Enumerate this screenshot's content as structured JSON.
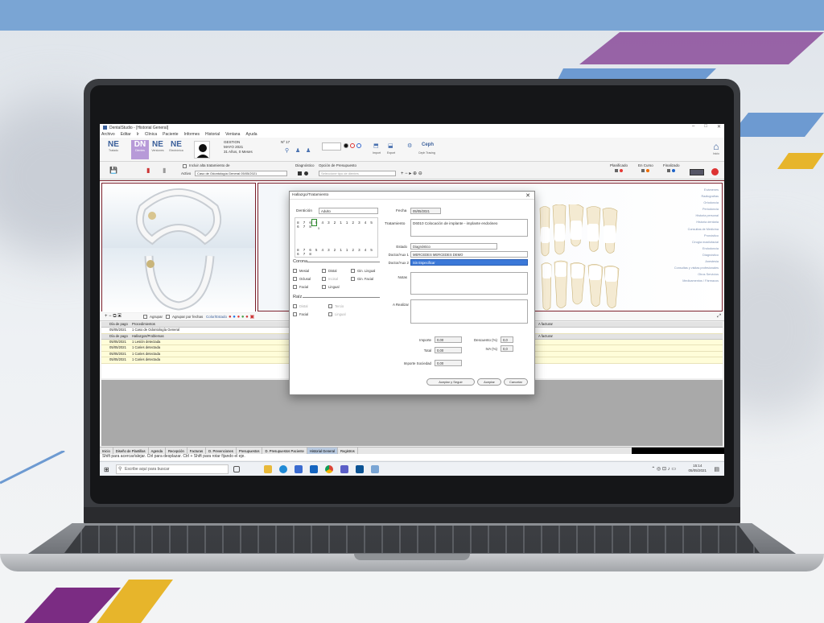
{
  "window": {
    "title": "DentalStudio - [Historial General]",
    "controls": [
      "–",
      "□",
      "✕"
    ]
  },
  "menu": [
    "Archivo",
    "Editar",
    "Ir",
    "Clínica",
    "Paciente",
    "Informes",
    "Historial",
    "Ventana",
    "Ayuda"
  ],
  "ribbon": {
    "modules": [
      {
        "code": "NE",
        "label": "Tratado"
      },
      {
        "code": "DN",
        "label": "Dientes"
      },
      {
        "code": "NE",
        "label": "Versiones"
      },
      {
        "code": "NE",
        "label": "Electrónica"
      }
    ],
    "patient": {
      "name": "GESTION",
      "line2": "MAYO 2021",
      "line3": "31 Años, 0 Meses",
      "number": "Nº 17"
    },
    "tool_labels": [
      "Import",
      "Export",
      "Ceph Tracing",
      "Ceph"
    ],
    "home_label": "Inicio"
  },
  "toolbar": {
    "checkbox_label": "Incluir alta tratamiento de",
    "active_label": "Activo",
    "treatment_select": "Caso de Odontología General 05/05/2021",
    "diagnostic_label": "Diagnóstico",
    "budget_label": "Opción de Presupuesto",
    "budget_select": "Seleccione tipo de dientes",
    "stages": [
      {
        "label": "Planificado",
        "color": "#e53935"
      },
      {
        "label": "En Curso",
        "color": "#ef6c00"
      },
      {
        "label": "Finalizado",
        "color": "#1e63c8"
      }
    ]
  },
  "right_links": [
    "Exámenes",
    "Radiografías",
    "Ortodoncia",
    "Periodoncia",
    "Historia personal",
    "Historia dentaria",
    "Consultas de Medicina",
    "Pronóstico",
    "Cirugía maxilofacial",
    "Endodoncia",
    "Diagnóstico",
    "Anestesia",
    "Consultas y visitas profesionales",
    "Otros Servicios",
    "Medicamentos / Fármacos"
  ],
  "grid_toolbar": {
    "agrupar_label": "Agrupar",
    "agrupar_fechas_label": "Agrupar por fechas",
    "color_label": "Color/Estado"
  },
  "grid": {
    "section1": {
      "headers": [
        "Día de pago",
        "Procedimientos",
        "",
        "A facturar"
      ],
      "rows": [
        {
          "date": "05/05/2021",
          "desc": "1 Caso de Odontología General"
        }
      ]
    },
    "section2": {
      "headers": [
        "Día de pago",
        "Hallazgos/Problemas",
        "",
        "A facturar"
      ],
      "rows": [
        {
          "date": "05/05/2021",
          "desc": "1 Lesión detectada"
        },
        {
          "date": "05/05/2021",
          "desc": "1 Caries detectada"
        },
        {
          "date": "05/05/2021",
          "desc": "1 Caries detectada"
        },
        {
          "date": "05/05/2021",
          "desc": "1 Caries detectada"
        }
      ]
    }
  },
  "tabs": [
    "Inicio",
    "Diseño de Plantillas",
    "Agenda",
    "Recepción",
    "Facturas",
    "D. Prevenciones",
    "Presupuestos",
    "D. Presupuestos Paciente",
    "Historial General",
    "Registros"
  ],
  "active_tab": "Historial General",
  "status": "Shift para acercar/alejar. Ctrl para desplazar. Ctrl + Shift para rotar fijando el eje.",
  "taskbar": {
    "search_placeholder": "Escribe aquí para buscar",
    "time": "15:14",
    "date": "05/05/2021"
  },
  "dialog": {
    "title": "Hallazgo/Tratamiento",
    "denticion_label": "Dentición",
    "denticion_value": "Adulto",
    "fecha_label": "Fecha",
    "fecha_value": "05/05/2021",
    "tratamiento_label": "Tratamiento",
    "tratamiento_value": "D6010 Colocación de implante - implante endoóseo",
    "upper_numbers": "8 7 6 5 4 3 2 1 1 2 3 4 5 6 7 8",
    "lower_numbers": "8 7 6 5 4 3 2 1 1 2 3 4 5 6 7 8",
    "selected_tooth": "5",
    "estado_label": "Estado",
    "estado_value": "Diagnóstico",
    "doctor1_label": "Doctor/Aux 1",
    "doctor1_value": "MERCEDES MERCEDES DEMO",
    "doctor2_label": "Doctor/Aux 2",
    "doctor2_value": "Sin Especificar",
    "notas_label": "Notas",
    "realizar_label": "A Realizar",
    "corona_label": "Corona",
    "corona_options": [
      {
        "label": "Mesial",
        "enabled": true
      },
      {
        "label": "Distal",
        "enabled": true
      },
      {
        "label": "Gin. Lingual",
        "enabled": true
      },
      {
        "label": "Oclusal",
        "enabled": true
      },
      {
        "label": "Incisal",
        "enabled": false
      },
      {
        "label": "Gin. Facial",
        "enabled": true
      },
      {
        "label": "Facial",
        "enabled": true
      },
      {
        "label": "Lingual",
        "enabled": true
      }
    ],
    "raiz_label": "Raíz",
    "raiz_options": [
      {
        "label": "Distal",
        "enabled": false
      },
      {
        "label": "Tercio",
        "enabled": false
      },
      {
        "label": "Facial",
        "enabled": true
      },
      {
        "label": "Lingual",
        "enabled": false
      }
    ],
    "importe_label": "Importe",
    "importe_value": "0,00",
    "descuento_label": "Descuento (%)",
    "descuento_value": "0,0",
    "total_label": "Total",
    "total_value": "0,00",
    "iva_label": "IVA (%)",
    "iva_value": "0,0",
    "sociedad_label": "Importe Sociedad",
    "sociedad_value": "0,00",
    "buttons": [
      "Aceptar y Seguir",
      "Aceptar",
      "Cancelar"
    ]
  },
  "colors": {
    "accent": "#3a5f9a",
    "selection": "#3b78d8",
    "frame": "#7a1e2a",
    "top_band": "#7aa5d4"
  }
}
